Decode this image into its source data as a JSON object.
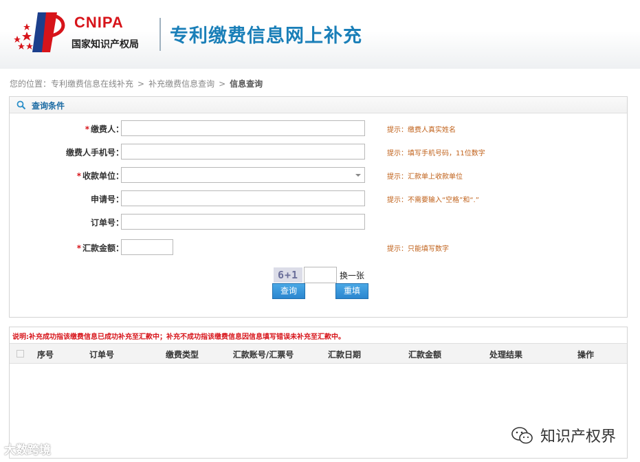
{
  "header": {
    "logo_text": "CNIPA",
    "logo_subtitle": "国家知识产权局",
    "title": "专利缴费信息网上补充"
  },
  "breadcrumb": {
    "prefix": "您的位置：",
    "items": [
      "专利缴费信息在线补充",
      "补充缴费信息查询",
      "信息查询"
    ],
    "separator": ">"
  },
  "query_panel": {
    "title": "查询条件",
    "fields": [
      {
        "label": "缴费人：",
        "required": true,
        "value": "",
        "hint": "提示：缴费人真实姓名"
      },
      {
        "label": "缴费人手机号：",
        "required": false,
        "value": "",
        "hint": "提示：填写手机号码，11位数字"
      },
      {
        "label": "收款单位：",
        "required": true,
        "value": "",
        "hint": "提示：汇款单上收款单位"
      },
      {
        "label": "申请号：",
        "required": false,
        "value": "",
        "hint": "提示：不需要输入“空格”和“.”"
      },
      {
        "label": "订单号：",
        "required": false,
        "value": "",
        "hint": ""
      },
      {
        "label": "汇款金额：",
        "required": true,
        "value": "",
        "hint": "提示：只能填写数字"
      }
    ],
    "required_mark": "*",
    "captcha_text": "6+1",
    "captcha_value": "",
    "captcha_refresh": "换一张",
    "query_button": "查询",
    "reset_button": "重填"
  },
  "results": {
    "note": "说明:补充成功指该缴费信息已成功补充至汇款中；补充不成功指该缴费信息因信息填写错误未补充至汇款中。",
    "columns": [
      "序号",
      "订单号",
      "缴费类型",
      "汇款账号/汇票号",
      "汇款日期",
      "汇款金额",
      "处理结果",
      "操作"
    ],
    "rows": []
  },
  "watermarks": {
    "left": "大数跨境",
    "right": "知识产权界"
  },
  "colors": {
    "brand_red": "#d7141a",
    "title_blue": "#1a7fb8",
    "hint_orange": "#c0611a",
    "button_blue": "#2b86cf"
  }
}
